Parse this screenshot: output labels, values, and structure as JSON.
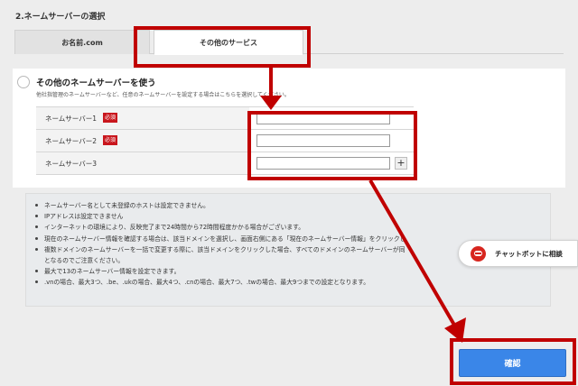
{
  "section_title": "2.ネームサーバーの選択",
  "tabs": [
    {
      "label": "お名前.com"
    },
    {
      "label": "その他のサービス"
    }
  ],
  "option": {
    "label": "その他のネームサーバーを使う",
    "description": "他社指管理のネームサーバーなど、任意のネームサーバーを設定する場合はこちらを選択してください。"
  },
  "nameservers": [
    {
      "label": "ネームサーバー1",
      "required_badge": "必須",
      "value": ""
    },
    {
      "label": "ネームサーバー2",
      "required_badge": "必須",
      "value": ""
    },
    {
      "label": "ネームサーバー3",
      "value": ""
    }
  ],
  "plus_label": "+",
  "notes": [
    "ネームサーバー名として未登録のホストは設定できません。",
    "IPアドレスは設定できません",
    "インターネットの環境により、反映完了まで24時間から72時間程度かかる場合がございます。",
    "現在のネームサーバー情報を確認する場合は、該当ドメインを選択し、画面右側にある「現在のネームサーバー情報」をクリックし",
    "複数ドメインのネームサーバーを一括で変更する際に、該当ドメインをクリックした場合、すべてのドメインのネームサーバーが同",
    "となるのでご注意ください。",
    "最大で13のネームサーバー情報を設定できます。",
    ".vnの場合、最大3つ、.be、.ukの場合、最大4つ、.cnの場合、最大7つ、.twの場合、最大9つまでの設定となります。"
  ],
  "chatbot": {
    "label": "チャットボットに相談",
    "icon": "chatbot-icon"
  },
  "confirm_button": "確認",
  "colors": {
    "accent": "#3a86e8",
    "annotation": "#c00000",
    "required": "#c9161d"
  }
}
